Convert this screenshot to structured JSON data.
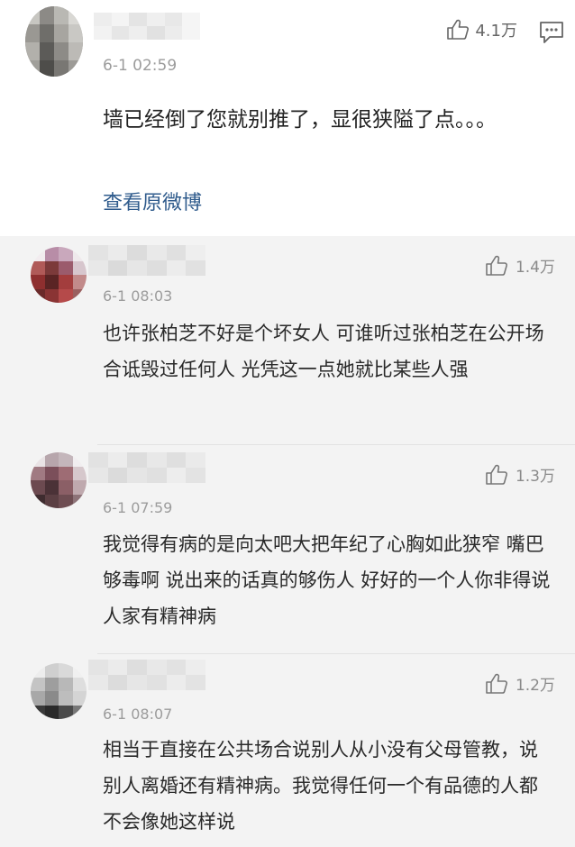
{
  "main_comment": {
    "timestamp": "6-1 02:59",
    "like_count": "4.1万",
    "text": "墙已经倒了您就别推了，显很狭隘了点。。。",
    "view_original_label": "查看原微博"
  },
  "replies": [
    {
      "timestamp": "6-1 08:03",
      "like_count": "1.4万",
      "text": "也许张柏芝不好是个坏女人 可谁听过张柏芝在公开场合诋毁过任何人 光凭这一点她就比某些人强"
    },
    {
      "timestamp": "6-1 07:59",
      "like_count": "1.3万",
      "text": "我觉得有病的是向太吧大把年纪了心胸如此狭窄  嘴巴够毒啊  说出来的话真的够伤人   好好的一个人你非得说人家有精神病"
    },
    {
      "timestamp": "6-1 08:07",
      "like_count": "1.2万",
      "text": "相当于直接在公共场合说别人从小没有父母管教，说别人离婚还有精神病。我觉得任何一个有品德的人都不会像她这样说"
    }
  ],
  "icons": {
    "like": "thumbs-up-icon",
    "comment": "comment-bubble-icon"
  },
  "colors": {
    "link": "#2f5b8c",
    "timestamp": "#9c9c9c",
    "reply_background": "#f3f3f3"
  }
}
